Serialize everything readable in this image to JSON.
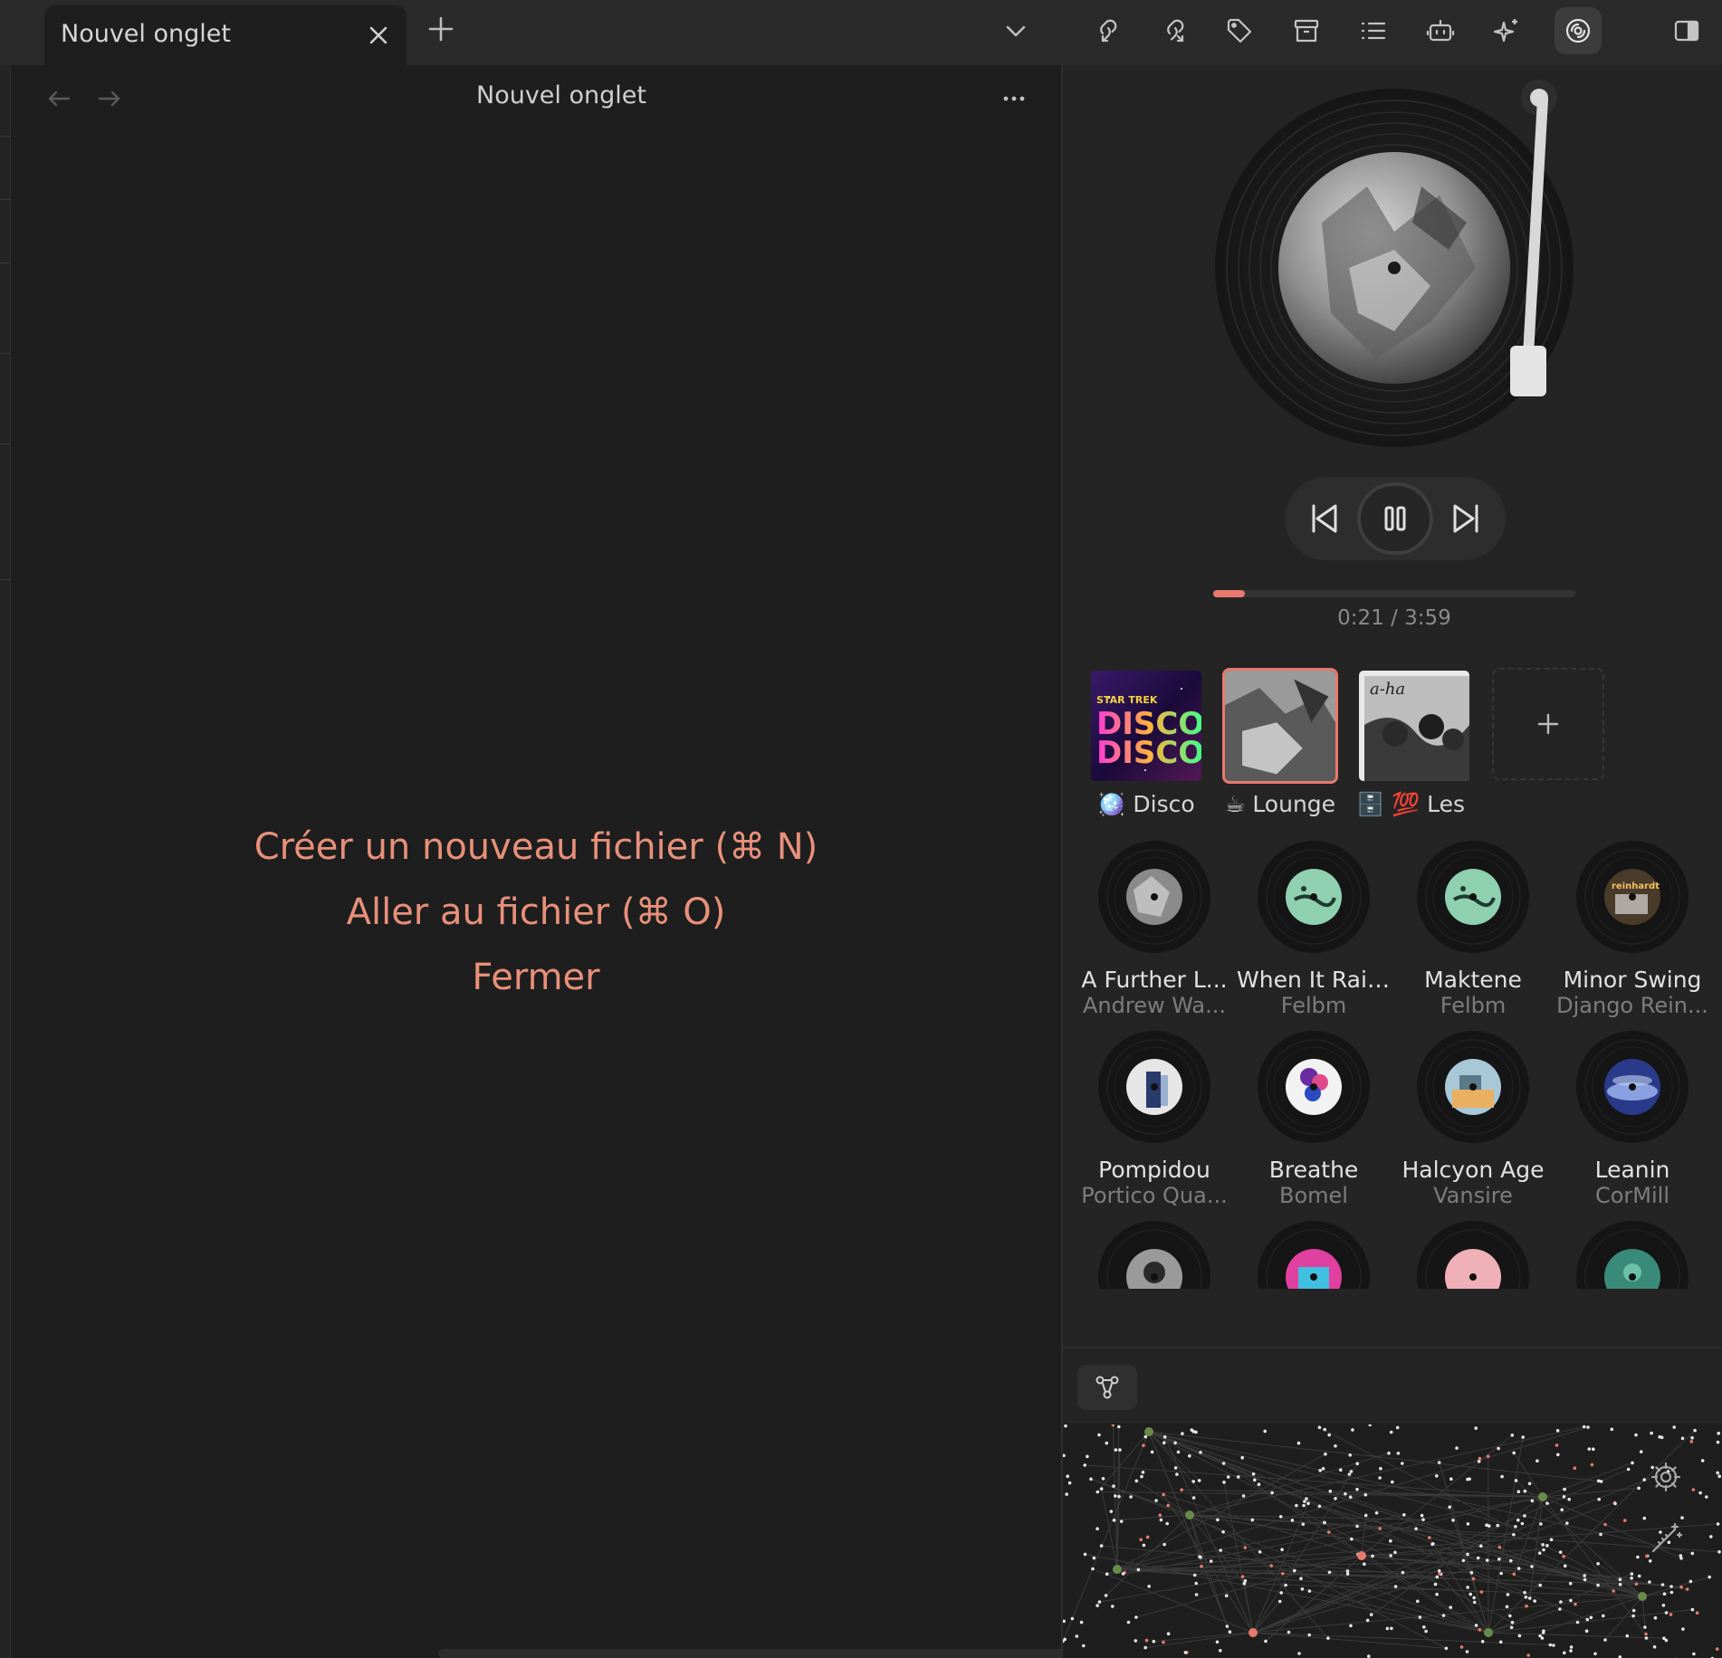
{
  "tabbar": {
    "tab_title": "Nouvel onglet",
    "toolbar_icons": [
      "backlinks-icon",
      "outgoing-links-icon",
      "tag-icon",
      "archive-icon",
      "outline-icon",
      "bot-icon",
      "sparkles-icon",
      "music-player-icon",
      "sidebar-toggle-icon"
    ],
    "active_tool": "music-player-icon"
  },
  "view": {
    "title": "Nouvel onglet",
    "actions": {
      "create_file": "Créer un nouveau fichier (⌘ N)",
      "goto_file": "Aller au fichier (⌘ O)",
      "close": "Fermer"
    }
  },
  "player": {
    "elapsed": "0:21",
    "duration": "3:59",
    "time_display": "0:21 / 3:59",
    "progress_fraction": 0.088,
    "accent_color": "#e8796c",
    "is_playing": true
  },
  "playlists": [
    {
      "emoji": "🪩",
      "label": "Disco",
      "cover_text": "STAR TREK DISCO DISCO",
      "selected": false
    },
    {
      "emoji": "☕",
      "label": "Lounge",
      "selected": true
    },
    {
      "emoji": "🗄️ 💯",
      "label": "Les plu",
      "cover_text": "a-ha",
      "selected": false
    }
  ],
  "tracks": [
    {
      "title": "A Further L...",
      "artist": "Andrew Wa..."
    },
    {
      "title": "When It Rains",
      "artist": "Felbm"
    },
    {
      "title": "Maktene",
      "artist": "Felbm"
    },
    {
      "title": "Minor Swing",
      "artist": "Django Rein...",
      "cover_text": "reinhardt"
    },
    {
      "title": "Pompidou",
      "artist": "Portico Qua..."
    },
    {
      "title": "Breathe",
      "artist": "Bomel"
    },
    {
      "title": "Halcyon Age",
      "artist": "Vansire"
    },
    {
      "title": "Leanin",
      "artist": "CorMill"
    }
  ],
  "graph": {
    "tab_icon": "graph-view-icon",
    "controls": [
      "settings-icon",
      "magic-wand-icon"
    ]
  }
}
